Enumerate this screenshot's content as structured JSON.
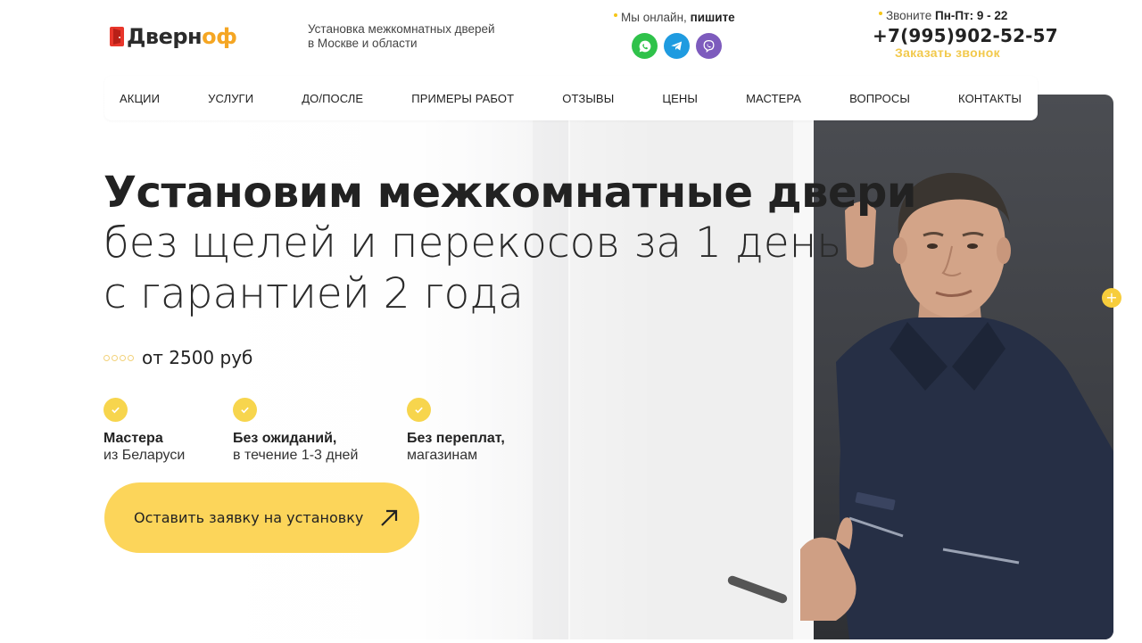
{
  "header": {
    "logo": {
      "part1": "Дверн",
      "part2": "оф"
    },
    "tagline": "Установка межкомнатных дверей в Москве и области",
    "online": {
      "prefix": "Мы онлайн,",
      "bold": "пишите"
    },
    "messengers": [
      {
        "name": "whatsapp",
        "icon": "whatsapp-icon",
        "color": "#2fc24a"
      },
      {
        "name": "telegram",
        "icon": "telegram-icon",
        "color": "#1f9be0"
      },
      {
        "name": "viber",
        "icon": "viber-icon",
        "color": "#7d5bbd"
      }
    ],
    "call": {
      "prefix": "Звоните",
      "hours": "Пн-Пт: 9 - 22",
      "phone": "+7(995)902-52-57",
      "order_label": "Заказать звонок"
    }
  },
  "nav": {
    "items": [
      "Акции",
      "Услуги",
      "До/после",
      "Примеры работ",
      "Отзывы",
      "Цены",
      "Мастера",
      "Вопросы",
      "Контакты"
    ]
  },
  "hero": {
    "title": "Установим межкомнатные двери",
    "subtitle_line1": "без щелей и перекосов за 1 день",
    "subtitle_line2": "с гарантией 2 года",
    "price": "от 2500 руб",
    "features": [
      {
        "title": "Мастера",
        "sub": "из Беларуси"
      },
      {
        "title": "Без ожиданий,",
        "sub": "в течение 1-3 дней"
      },
      {
        "title": "Без переплат,",
        "sub": "магазинам"
      }
    ],
    "cta_label": "Оставить заявку на установку",
    "plus_label": "+"
  },
  "colors": {
    "accent": "#fcd55a",
    "brand_red": "#e8362b",
    "brand_orange": "#f5a623",
    "text": "#222222"
  }
}
